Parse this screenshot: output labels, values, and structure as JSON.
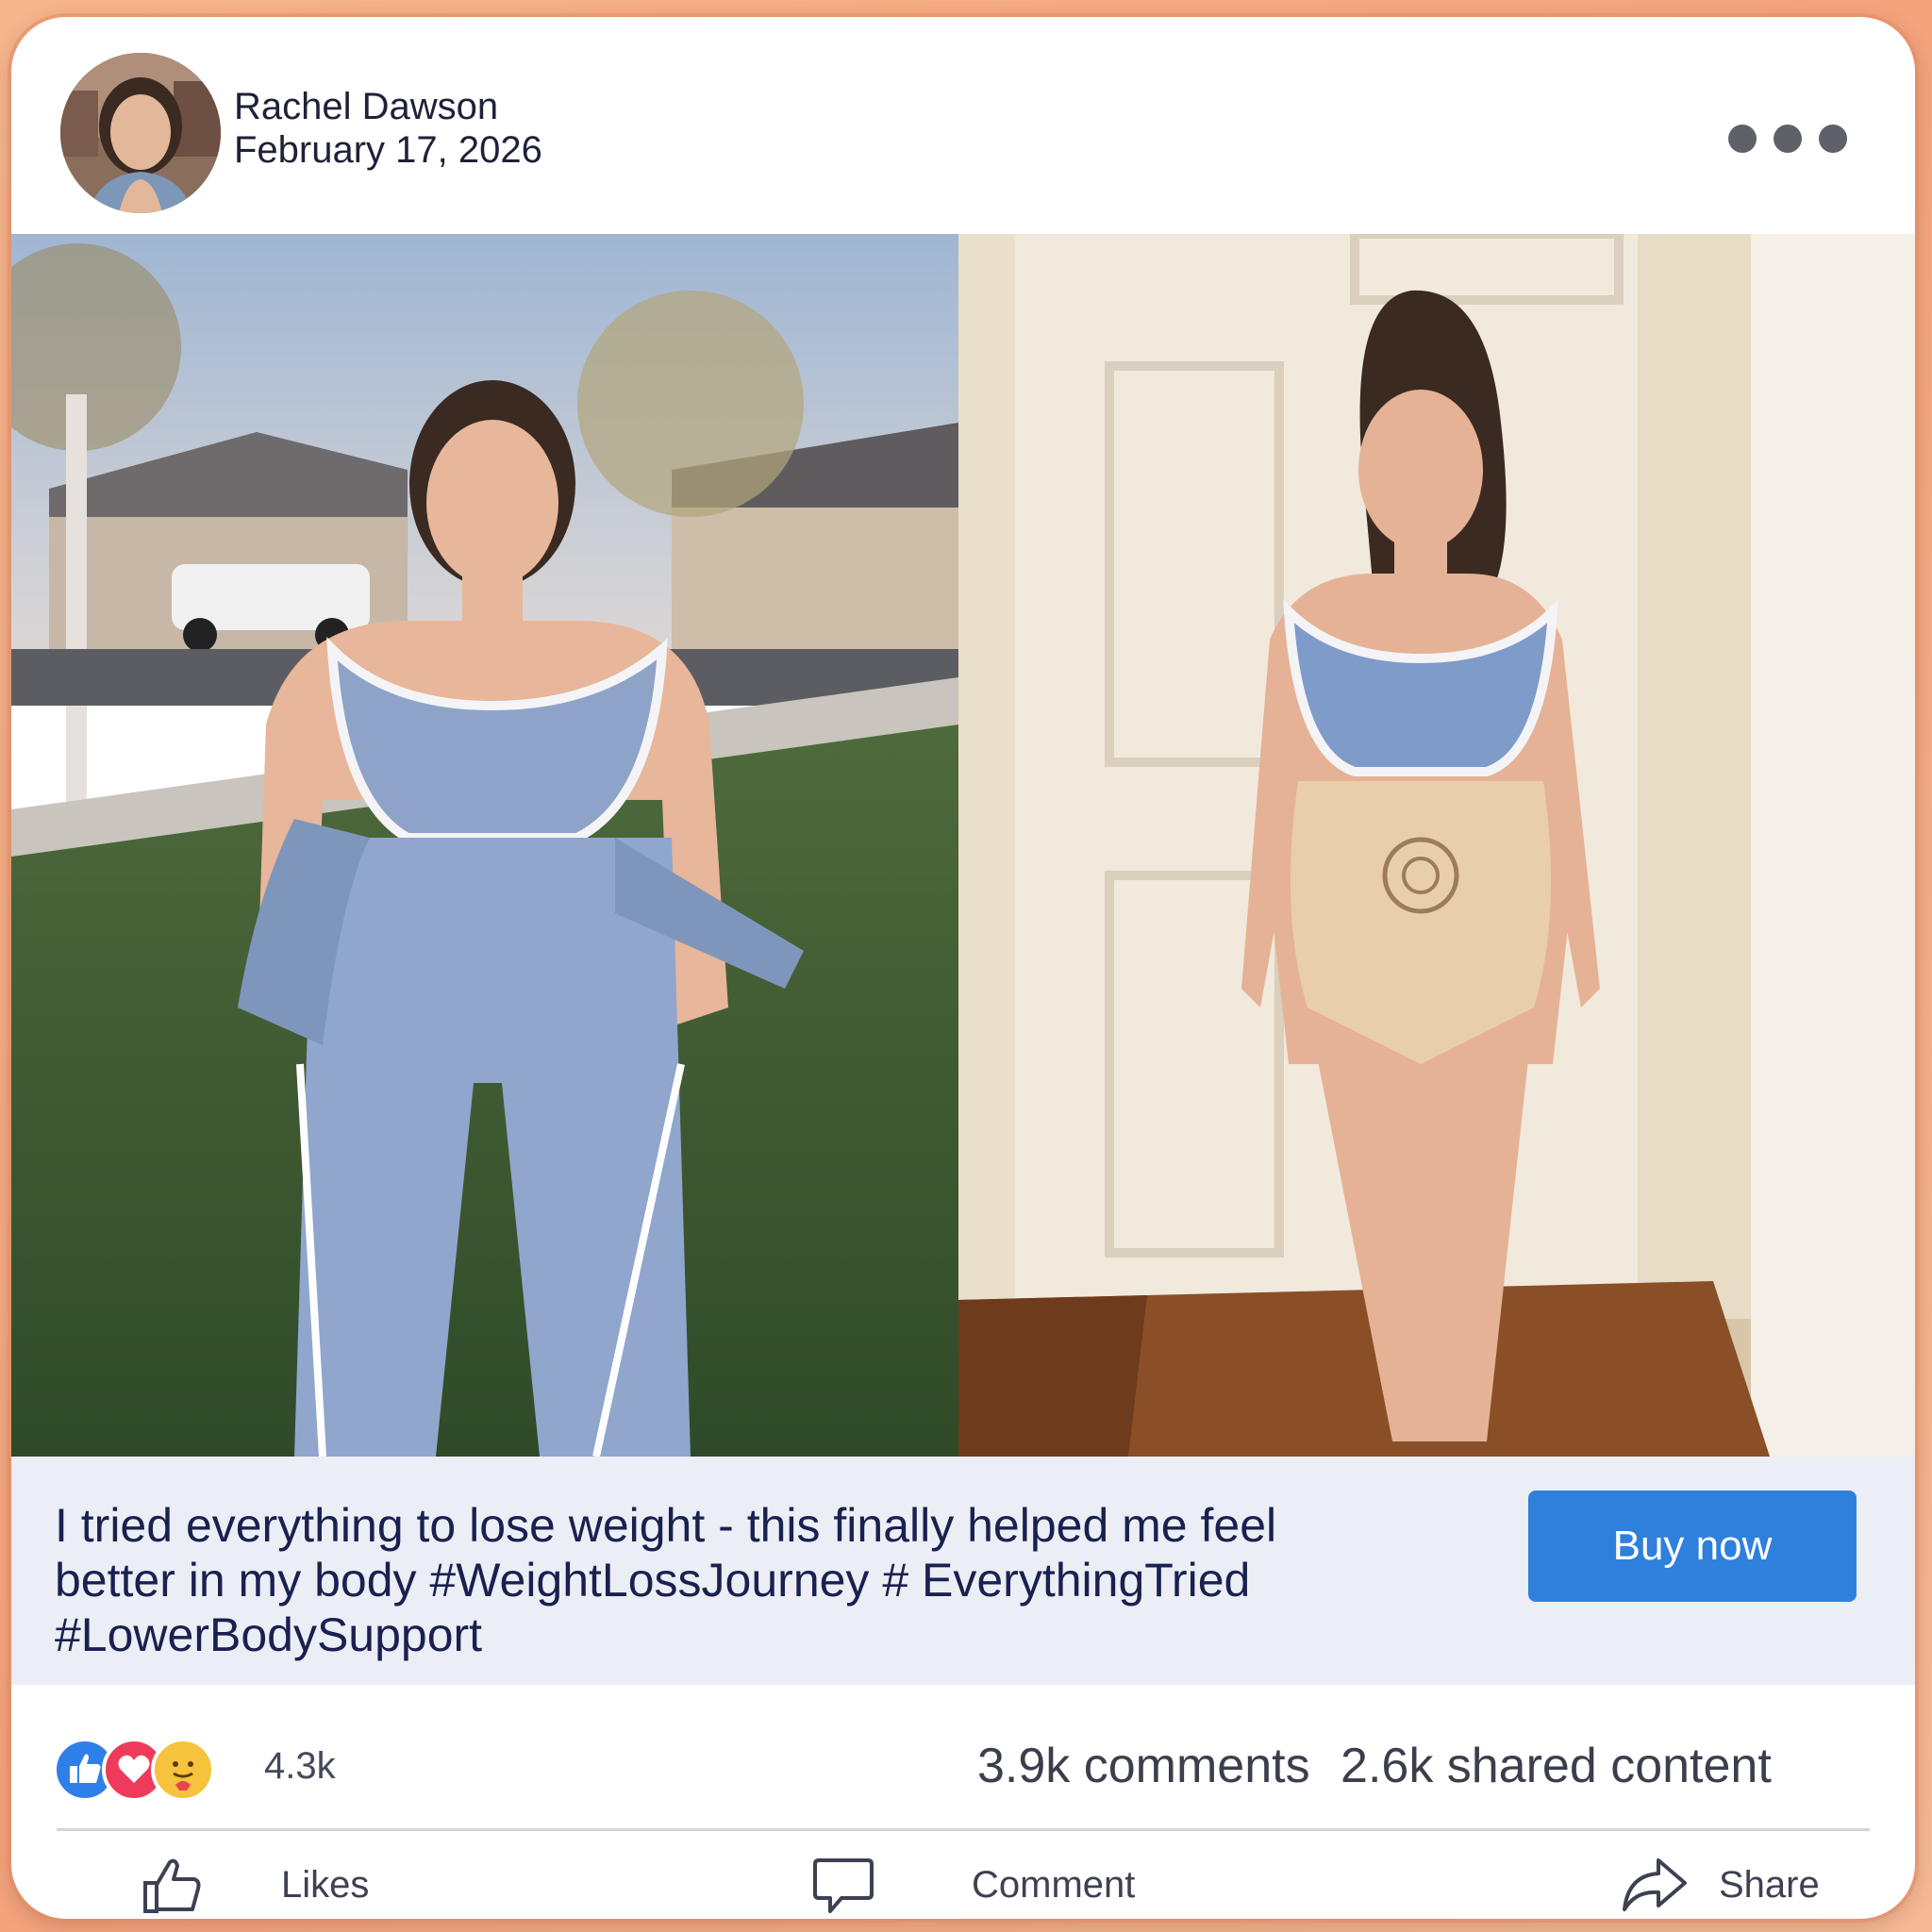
{
  "post": {
    "author": "Rachel Dawson",
    "date": "February 17, 2026",
    "caption": "I tried everything to lose weight - this finally helped me feel better in my body #WeightLossJourney # EverythingTried #LowerBodySupport",
    "cta_label": "Buy now"
  },
  "stats": {
    "reactions_count": "4.3k",
    "comments": "3.9k comments",
    "shares": "2.6k shared content",
    "reaction_icons": [
      "like-icon",
      "love-icon",
      "care-icon"
    ]
  },
  "actions": {
    "like_label": "Likes",
    "comment_label": "Comment",
    "share_label": "Share"
  },
  "colors": {
    "accent": "#2f80dd",
    "caption_text": "#1a2150",
    "caption_background": "#eceef5",
    "page_background": "#f4a37c"
  }
}
